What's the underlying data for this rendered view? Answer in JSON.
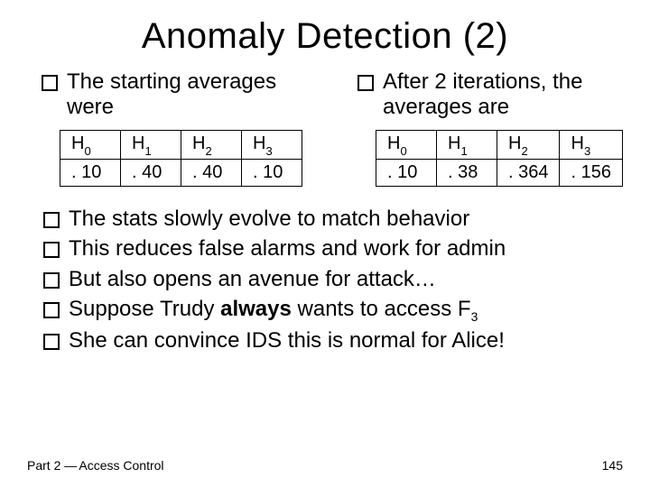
{
  "title": "Anomaly Detection (2)",
  "left": {
    "lead": "The starting averages were"
  },
  "right": {
    "lead": "After 2 iterations, the averages are"
  },
  "chart_data": [
    {
      "type": "table",
      "title": "Starting averages",
      "headers": [
        "H0",
        "H1",
        "H2",
        "H3"
      ],
      "row": [
        ". 10",
        ". 40",
        ". 40",
        ". 10"
      ]
    },
    {
      "type": "table",
      "title": "After 2 iterations",
      "headers": [
        "H0",
        "H1",
        "H2",
        "H3"
      ],
      "row": [
        ". 10",
        ". 38",
        ". 364",
        ". 156"
      ]
    }
  ],
  "bullets": {
    "b0": "The stats slowly evolve to match behavior",
    "b1": "This reduces false alarms and work for admin",
    "b2": "But also opens an avenue for attack…",
    "b3_pre": "Suppose Trudy ",
    "b3_bold": "always",
    "b3_mid": " wants to access ",
    "b3_f": "F",
    "b3_sub": "3",
    "b4": "She can convince IDS this is normal for Alice!"
  },
  "footer": {
    "left_a": "Part 2 ",
    "left_dash": "—",
    "left_b": " Access Control",
    "page": "145"
  }
}
